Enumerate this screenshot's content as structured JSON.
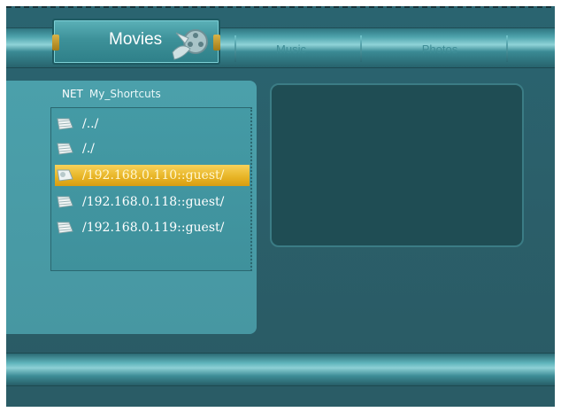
{
  "nav": {
    "tabs": [
      {
        "label": "Movies",
        "active": true
      },
      {
        "label": "Music",
        "active": false
      },
      {
        "label": "Photos",
        "active": false
      }
    ]
  },
  "browser": {
    "sources": [
      "NET",
      "My_Shortcuts"
    ],
    "items": [
      {
        "label": "/../",
        "icon": "folder-icon",
        "selected": false
      },
      {
        "label": "/./",
        "icon": "folder-icon",
        "selected": false
      },
      {
        "label": "/192.168.0.110::guest/",
        "icon": "network-share-icon",
        "selected": true
      },
      {
        "label": "/192.168.0.118::guest/",
        "icon": "network-share-icon",
        "selected": false
      },
      {
        "label": "/192.168.0.119::guest/",
        "icon": "network-share-icon",
        "selected": false
      }
    ]
  },
  "colors": {
    "background": "#2b5f6a",
    "panel": "#4797a2",
    "preview": "#1f4d54",
    "highlight": "#e7b324",
    "inactive_tab_text": "#3f8d96"
  }
}
